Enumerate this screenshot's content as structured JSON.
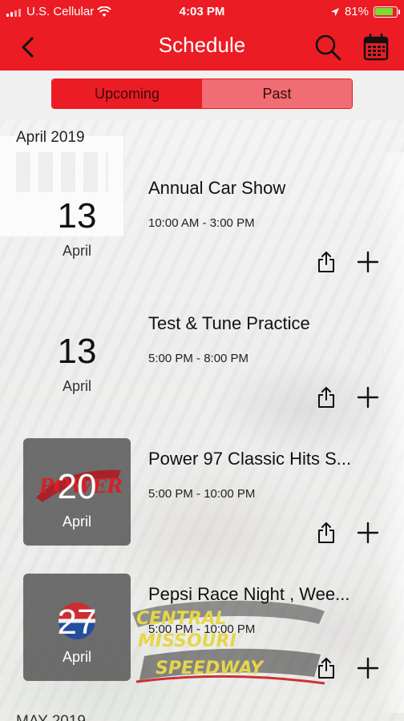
{
  "status_bar": {
    "carrier": "U.S. Cellular",
    "time": "4:03 PM",
    "battery": "81%"
  },
  "header": {
    "title": "Schedule",
    "back_icon": "chevron-left-icon",
    "search_icon": "search-icon",
    "calendar_icon": "calendar-icon"
  },
  "tabs": [
    {
      "label": "Upcoming",
      "active": true
    },
    {
      "label": "Past",
      "active": false
    }
  ],
  "sections": [
    {
      "month": "April 2019",
      "events": [
        {
          "day": "13",
          "month": "April",
          "title": "Annual Car Show",
          "time": "10:00 AM - 3:00 PM"
        },
        {
          "day": "13",
          "month": "April",
          "title": "Test & Tune Practice",
          "time": "5:00 PM - 8:00 PM"
        },
        {
          "day": "20",
          "month": "April",
          "title": "Power 97 Classic Hits S...",
          "time": "5:00 PM - 10:00 PM",
          "logo_text": "POWER 97"
        },
        {
          "day": "27",
          "month": "April",
          "title": "Pepsi Race Night , Wee...",
          "time": "5:00 PM - 10:00 PM"
        }
      ]
    },
    {
      "month": "MAY 2019"
    }
  ],
  "watermark": {
    "line1": "CENTRAL",
    "line2": "MISSOURI",
    "line3": "SPEEDWAY"
  },
  "colors": {
    "brand_red": "#eb1c24",
    "tab_inactive": "#ef6d73"
  }
}
